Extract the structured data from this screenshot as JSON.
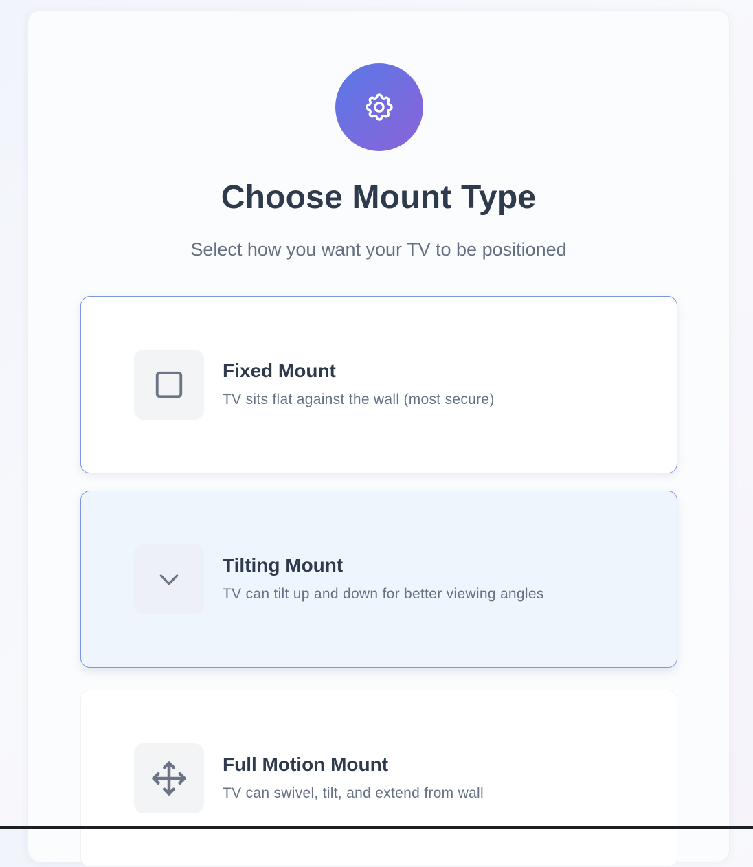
{
  "header": {
    "icon": "gear-icon",
    "title": "Choose Mount Type",
    "subtitle": "Select how you want your TV to be positioned"
  },
  "options": [
    {
      "icon": "square-icon",
      "name": "Fixed Mount",
      "description": "TV sits flat against the wall (most secure)"
    },
    {
      "icon": "chevron-down-icon",
      "name": "Tilting Mount",
      "description": "TV can tilt up and down for better viewing angles"
    },
    {
      "icon": "move-arrows-icon",
      "name": "Full Motion Mount",
      "description": "TV can swivel, tilt, and extend from wall"
    }
  ],
  "colors": {
    "accent_gradient_start": "#5a78e6",
    "accent_gradient_end": "#8b63d9",
    "selected_border": "#7c96e3",
    "hover_background": "#eff5fc",
    "title_text": "#2f3a4c",
    "muted_text": "#667284"
  }
}
